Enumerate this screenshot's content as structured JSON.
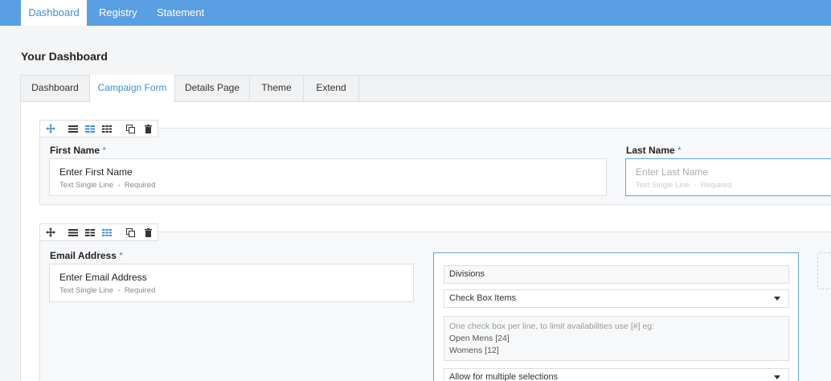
{
  "topnav": {
    "tabs": [
      {
        "label": "Dashboard",
        "active": true
      },
      {
        "label": "Registry",
        "active": false
      },
      {
        "label": "Statement",
        "active": false
      }
    ]
  },
  "page": {
    "title": "Your Dashboard"
  },
  "subtabs": [
    {
      "label": "Dashboard",
      "active": false
    },
    {
      "label": "Campaign Form",
      "active": true
    },
    {
      "label": "Details Page",
      "active": false
    },
    {
      "label": "Theme",
      "active": false
    },
    {
      "label": "Extend",
      "active": false
    }
  ],
  "row1": {
    "first_name": {
      "label": "First Name",
      "required_mark": "*",
      "placeholder": "Enter First Name",
      "type": "Text Single Line",
      "separator": "-",
      "required": "Required"
    },
    "last_name": {
      "label": "Last Name",
      "required_mark": "*",
      "placeholder": "Enter Last Name",
      "type": "Text Single Line",
      "separator": "-",
      "required": "Required"
    }
  },
  "row2": {
    "email": {
      "label": "Email Address",
      "required_mark": "*",
      "placeholder": "Enter Email Address",
      "type": "Text Single Line",
      "separator": "-",
      "required": "Required"
    },
    "options": {
      "field_name": "Divisions",
      "type_select": "Check Box Items",
      "hint": "One check box per line, to limit availabilities use [#] eg:",
      "lines": [
        "Open Mens  [24]",
        "Womens  [12]"
      ],
      "multi_select": "Allow for multiple selections"
    }
  },
  "colors": {
    "accent": "#3d8fd8",
    "topbar": "#5a9fe3",
    "focus_border": "#5aa3e6"
  },
  "icons": [
    "move-icon",
    "one-column-icon",
    "two-column-icon",
    "three-column-icon",
    "duplicate-icon",
    "trash-icon",
    "dropdown-caret-icon"
  ]
}
